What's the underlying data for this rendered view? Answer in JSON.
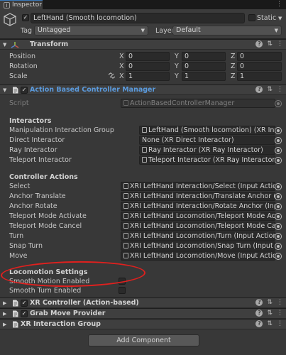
{
  "tab": {
    "label": "Inspector"
  },
  "gameobject": {
    "name": "LeftHand (Smooth locomotion)",
    "active": true,
    "static_label": "Static",
    "tag_label": "Tag",
    "tag_value": "Untagged",
    "layer_label": "Layer",
    "layer_value": "Default"
  },
  "transform": {
    "title": "Transform",
    "rows": [
      {
        "label": "Position",
        "x": "0",
        "y": "0",
        "z": "0"
      },
      {
        "label": "Rotation",
        "x": "0",
        "y": "0",
        "z": "0"
      },
      {
        "label": "Scale",
        "x": "1",
        "y": "1",
        "z": "1"
      }
    ],
    "axis": {
      "x": "X",
      "y": "Y",
      "z": "Z"
    }
  },
  "manager": {
    "title": "Action Based Controller Manager",
    "script_label": "Script",
    "script_value": "ActionBasedControllerManager",
    "interactors_title": "Interactors",
    "interactors": [
      {
        "label": "Manipulation Interaction Group",
        "value": "LeftHand (Smooth locomotion) (XR Interaction Group)"
      },
      {
        "label": "Direct Interactor",
        "value": "None (XR Direct Interactor)"
      },
      {
        "label": "Ray Interactor",
        "value": "Ray Interactor (XR Ray Interactor)"
      },
      {
        "label": "Teleport Interactor",
        "value": "Teleport Interactor (XR Ray Interactor)"
      }
    ],
    "actions_title": "Controller Actions",
    "actions": [
      {
        "label": "Select",
        "value": "XRI LeftHand Interaction/Select (Input Action Referenc"
      },
      {
        "label": "Anchor Translate",
        "value": "XRI LeftHand Interaction/Translate Anchor (Input Actio"
      },
      {
        "label": "Anchor Rotate",
        "value": "XRI LeftHand Interaction/Rotate Anchor (Input Action R"
      },
      {
        "label": "Teleport Mode Activate",
        "value": "XRI LeftHand Locomotion/Teleport Mode Activate (Inp"
      },
      {
        "label": "Teleport Mode Cancel",
        "value": "XRI LeftHand Locomotion/Teleport Mode Cancel (Inpu"
      },
      {
        "label": "Turn",
        "value": "XRI LeftHand Locomotion/Turn (Input Action Referenc"
      },
      {
        "label": "Snap Turn",
        "value": "XRI LeftHand Locomotion/Snap Turn (Input Action Ref"
      },
      {
        "label": "Move",
        "value": "XRI LeftHand Locomotion/Move (Input Action Referenc"
      }
    ],
    "locomotion_title": "Locomotion Settings",
    "locomotion": [
      {
        "label": "Smooth Motion Enabled",
        "checked": false
      },
      {
        "label": "Smooth Turn Enabled",
        "checked": false
      }
    ]
  },
  "components": [
    {
      "title": "XR Controller (Action-based)"
    },
    {
      "title": "Grab Move Provider"
    },
    {
      "title": "XR Interaction Group"
    }
  ],
  "add_component_label": "Add Component",
  "colors": {
    "background": "#383838",
    "accent_blue": "#5b9bde",
    "annotation_red": "#e0201e"
  }
}
